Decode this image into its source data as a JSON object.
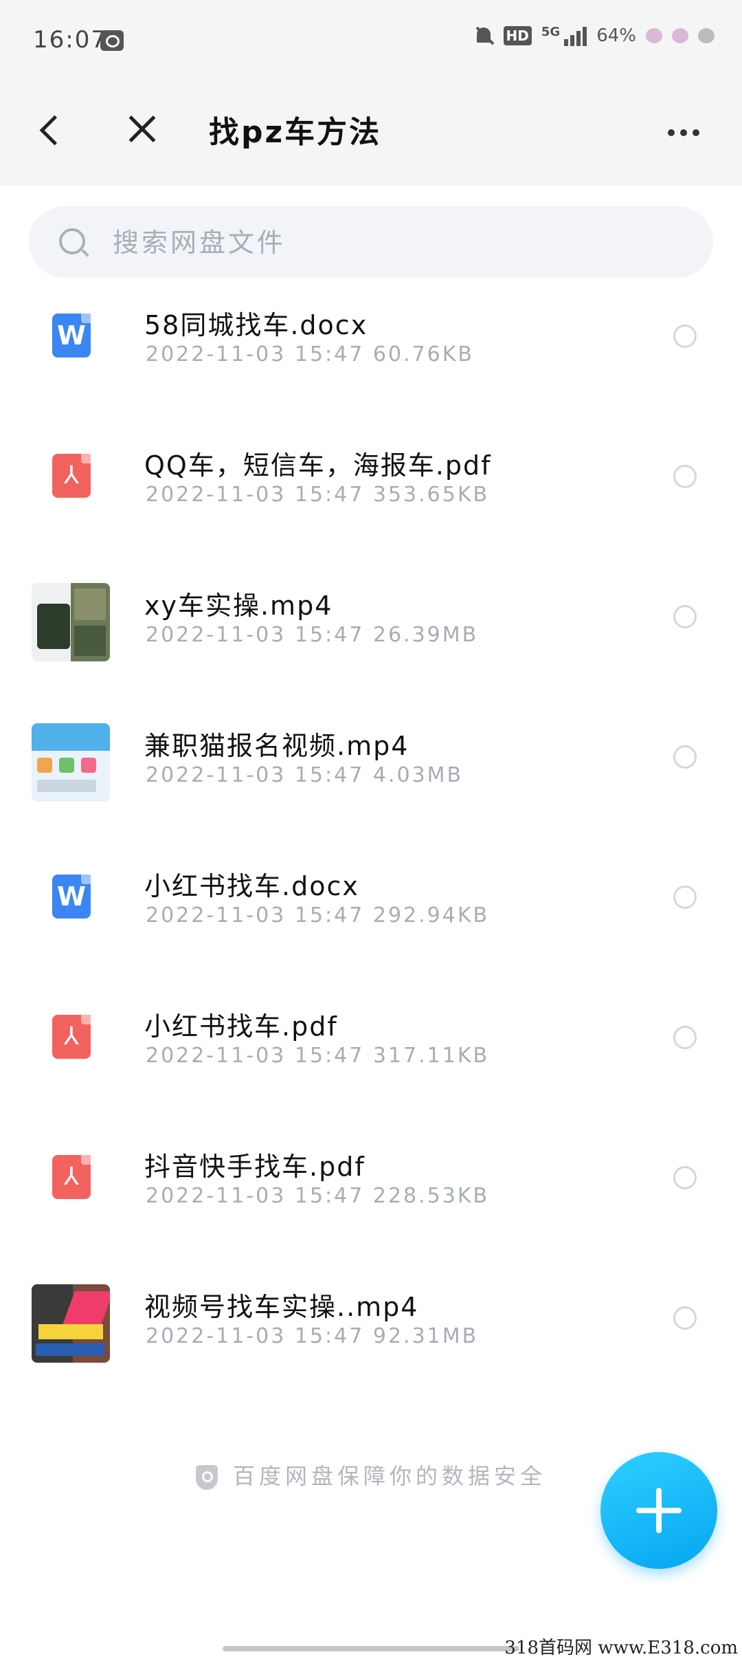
{
  "status_bar": {
    "time": "16:07",
    "network": "5G",
    "hd": "HD",
    "battery": "64%"
  },
  "header": {
    "title": "找pz车方法"
  },
  "search": {
    "placeholder": "搜索网盘文件"
  },
  "files": [
    {
      "name": "58同城找车.docx",
      "meta": "2022-11-03  15:47  60.76KB",
      "type": "word",
      "icon_letter": "W"
    },
    {
      "name": "QQ车，短信车，海报车.pdf",
      "meta": "2022-11-03  15:47  353.65KB",
      "type": "pdf"
    },
    {
      "name": "xy车实操.mp4",
      "meta": "2022-11-03  15:47  26.39MB",
      "type": "video"
    },
    {
      "name": "兼职猫报名视频.mp4",
      "meta": "2022-11-03  15:47  4.03MB",
      "type": "video"
    },
    {
      "name": "小红书找车.docx",
      "meta": "2022-11-03  15:47  292.94KB",
      "type": "word",
      "icon_letter": "W"
    },
    {
      "name": "小红书找车.pdf",
      "meta": "2022-11-03  15:47  317.11KB",
      "type": "pdf"
    },
    {
      "name": "抖音快手找车.pdf",
      "meta": "2022-11-03  15:47  228.53KB",
      "type": "pdf"
    },
    {
      "name": "视频号找车实操..mp4",
      "meta": "2022-11-03  15:47  92.31MB",
      "type": "video"
    }
  ],
  "footer": {
    "safety_text": "百度网盘保障你的数据安全"
  },
  "watermark": "318首码网 www.E318.com",
  "colors": {
    "accent": "#06a5f2",
    "word": "#3c86f4",
    "pdf": "#f2625f"
  }
}
